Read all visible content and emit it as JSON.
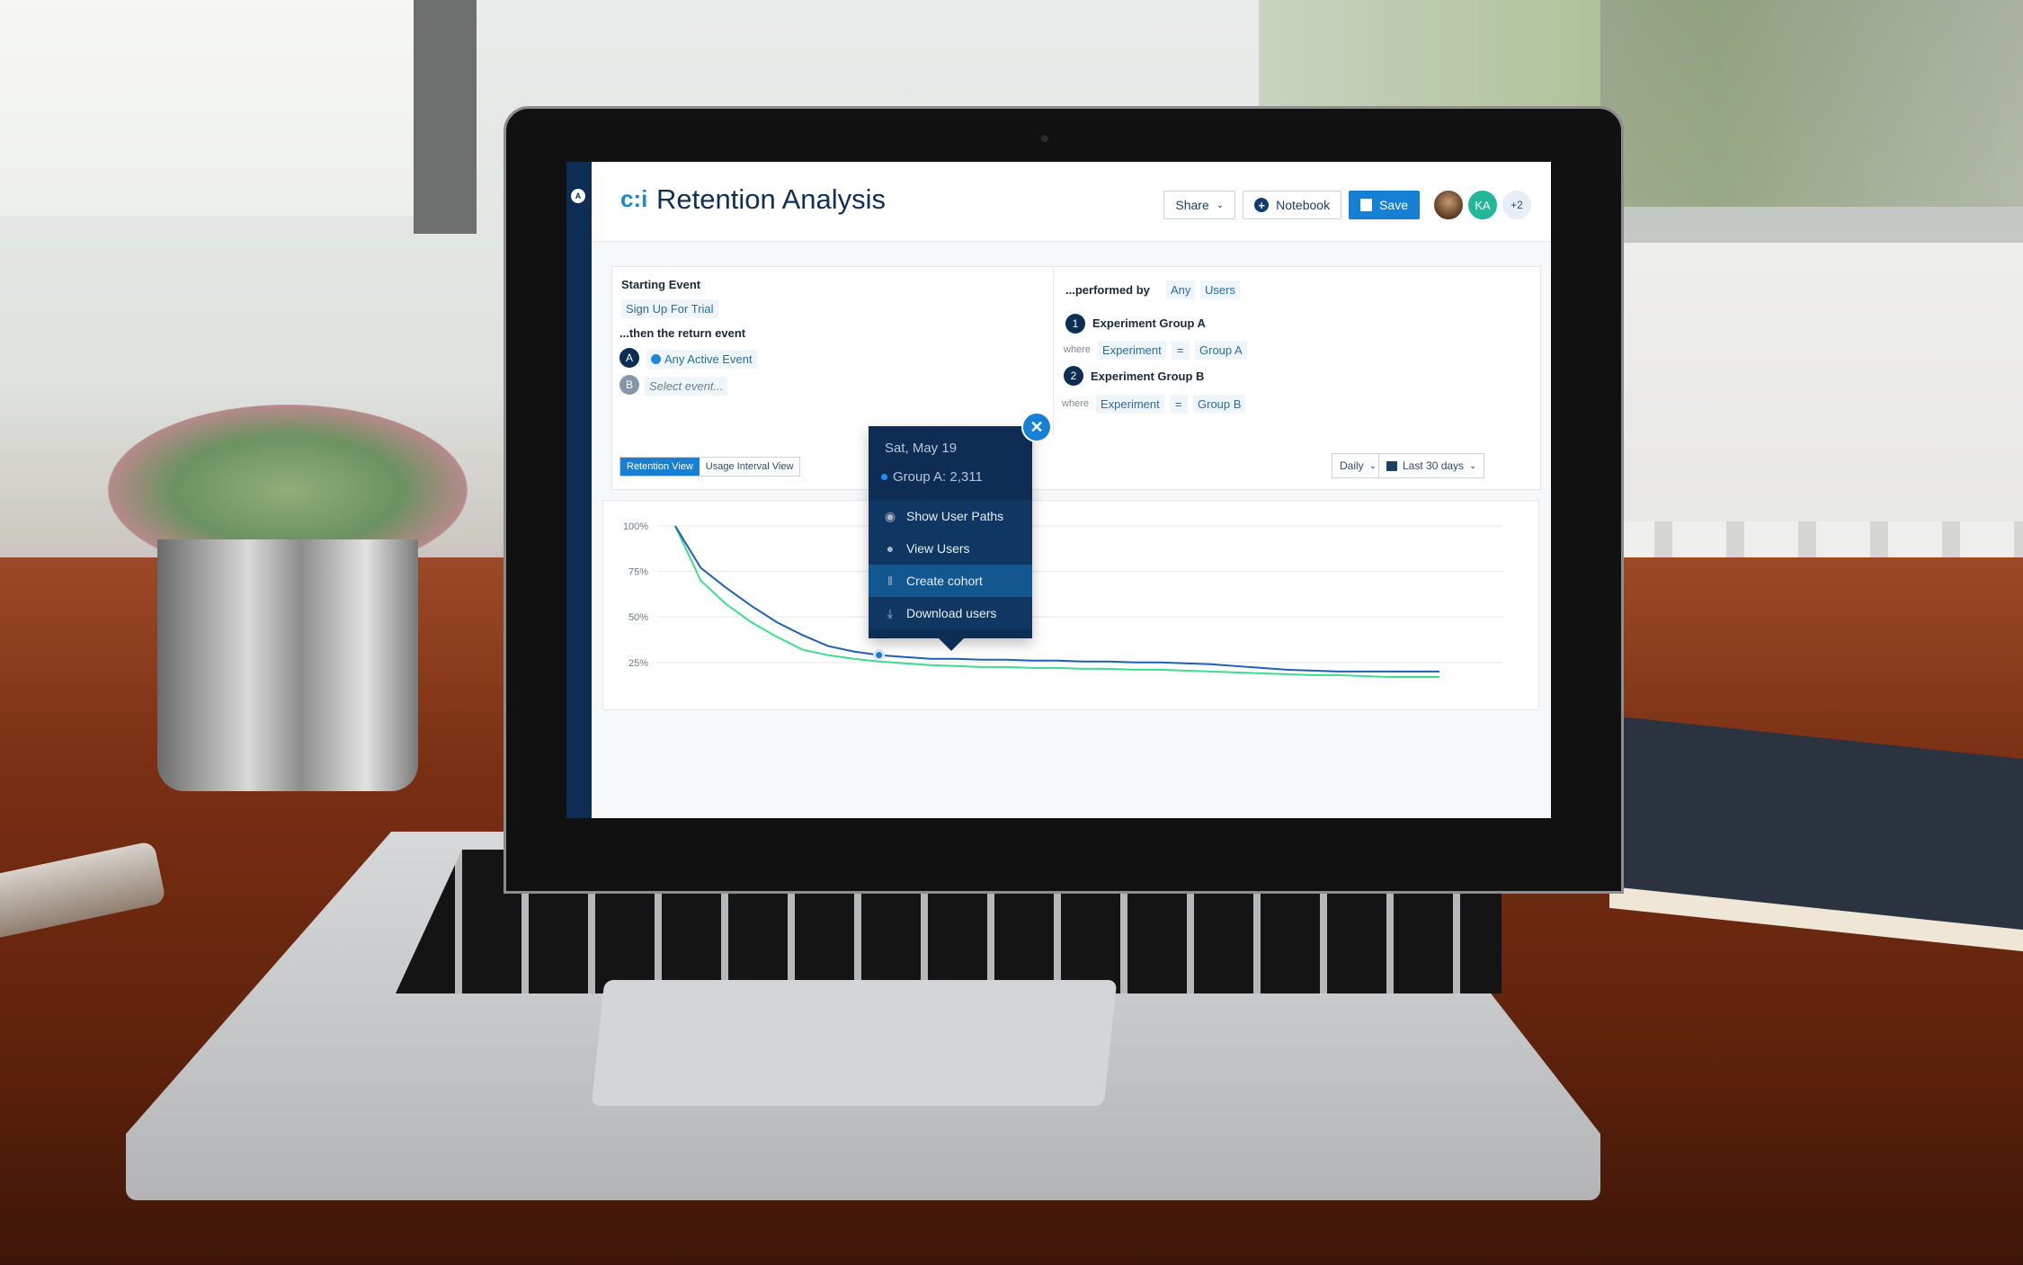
{
  "app": {
    "brand_mark": "c:i",
    "title": "Retention Analysis",
    "sidebar_icon": "amplitude-logo-icon"
  },
  "header": {
    "share_label": "Share",
    "notebook_label": "Notebook",
    "save_label": "Save",
    "collaborators": [
      {
        "type": "photo",
        "label": ""
      },
      {
        "type": "initials",
        "label": "KA",
        "color": "#23b79a"
      },
      {
        "type": "overflow",
        "label": "+2"
      }
    ]
  },
  "query": {
    "starting_event_label": "Starting Event",
    "starting_event_value": "Sign Up For Trial",
    "return_event_label": "...then the return event",
    "return_events": [
      {
        "badge": "A",
        "value": "Any Active Event",
        "icon": "activity-icon"
      },
      {
        "badge": "B",
        "value": "",
        "placeholder": "Select event..."
      }
    ],
    "performed_by_label": "...performed by",
    "performed_by_scope": "Any",
    "performed_by_entity": "Users",
    "segments": [
      {
        "index": "1",
        "name": "Experiment Group A",
        "where_label": "where",
        "property": "Experiment",
        "operator": "=",
        "value": "Group A"
      },
      {
        "index": "2",
        "name": "Experiment Group B",
        "where_label": "where",
        "property": "Experiment",
        "operator": "=",
        "value": "Group B"
      }
    ]
  },
  "toolbar": {
    "view_tabs": [
      {
        "label": "Retention View",
        "active": true
      },
      {
        "label": "Usage Interval View",
        "active": false
      }
    ],
    "interval": "Daily",
    "date_range": "Last 30 days"
  },
  "tooltip": {
    "date": "Sat, May 19",
    "series_label": "Group A: 2,311",
    "menu": [
      {
        "label": "Show User Paths",
        "icon": "eye-icon",
        "highlighted": false
      },
      {
        "label": "View Users",
        "icon": "user-icon",
        "highlighted": false
      },
      {
        "label": "Create cohort",
        "icon": "cohort-icon",
        "highlighted": true
      },
      {
        "label": "Download users",
        "icon": "download-icon",
        "highlighted": false
      }
    ]
  },
  "colors": {
    "primary": "#1680d4",
    "navy": "#0d2d55",
    "series_a": "#1f5fb8",
    "series_b": "#3ddc8e"
  },
  "chart_data": {
    "type": "line",
    "title": "",
    "xlabel": "",
    "ylabel": "",
    "ylim": [
      0,
      100
    ],
    "yticks": [
      "100%",
      "75%",
      "50%",
      "25%"
    ],
    "ytick_values": [
      100,
      75,
      50,
      25
    ],
    "grid": true,
    "legend": "none",
    "x": [
      0,
      1,
      2,
      3,
      4,
      5,
      6,
      7,
      8,
      9,
      10,
      11,
      12,
      13,
      14,
      15,
      16,
      17,
      18,
      19,
      20,
      21,
      22,
      23,
      24,
      25,
      26,
      27,
      28,
      29,
      30
    ],
    "series": [
      {
        "name": "Group A",
        "color": "#1f5fb8",
        "values": [
          100,
          77,
          66,
          56,
          47,
          40,
          34,
          31,
          29,
          28,
          27,
          27,
          26.5,
          26.5,
          26,
          26,
          25.5,
          25.5,
          25,
          25,
          24.5,
          24,
          23,
          22,
          21,
          20.5,
          20,
          20,
          20,
          20,
          20
        ]
      },
      {
        "name": "Group B",
        "color": "#3ddc8e",
        "values": [
          100,
          70,
          57,
          47,
          39,
          32,
          29,
          27,
          25.5,
          24.5,
          23.5,
          23,
          22.5,
          22.5,
          22,
          22,
          21.5,
          21.5,
          21,
          21,
          20.5,
          20,
          19.5,
          19,
          18.5,
          18,
          18,
          17.5,
          17,
          17,
          17
        ]
      }
    ],
    "highlight": {
      "series": "Group A",
      "x": 8,
      "label": "Sat, May 19",
      "value": 2311
    }
  }
}
